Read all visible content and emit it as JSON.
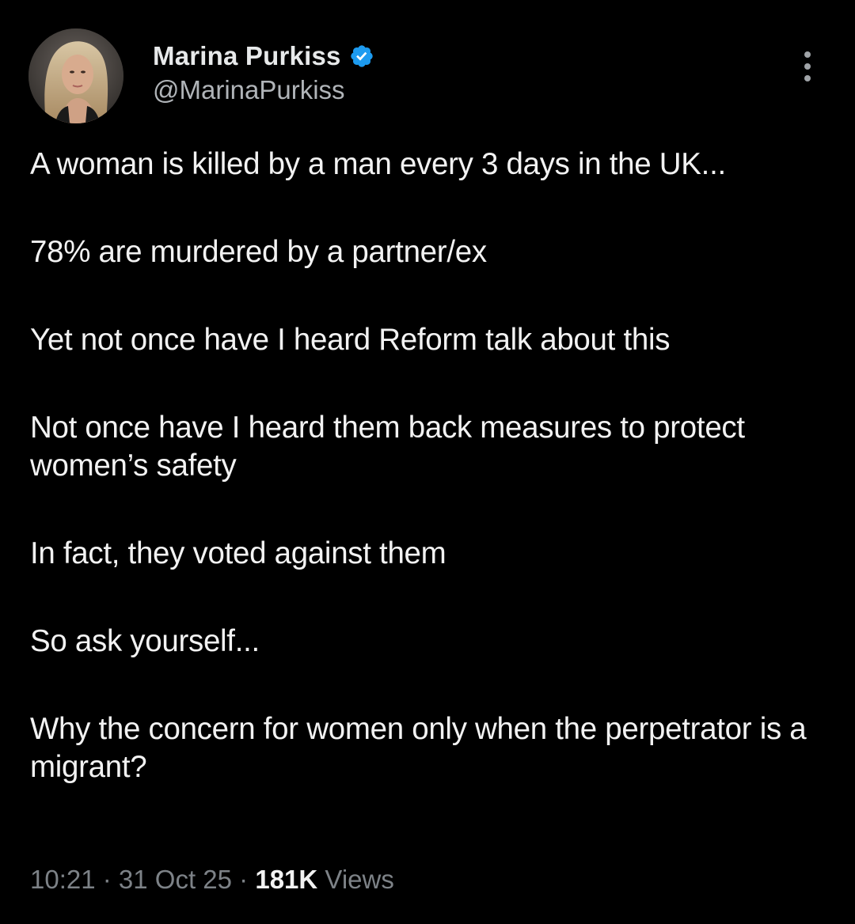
{
  "author": {
    "display_name": "Marina Purkiss",
    "handle": "@MarinaPurkiss",
    "verified": true,
    "verified_color": "#1d9bf0"
  },
  "icons": {
    "verified": "verified-badge-icon",
    "more": "more-options-icon"
  },
  "tweet": {
    "paragraphs": [
      "A woman is killed by a man every 3 days in the UK...",
      "78% are murdered by a partner/ex",
      "Yet not once have I heard Reform talk about this",
      "Not once have I heard them back measures to protect women’s safety",
      "In fact, they voted against them",
      "So ask yourself...",
      "Why the concern for women only when the perpetrator is a migrant?"
    ],
    "time": "10:21",
    "date": "31 Oct 25",
    "separator": " · ",
    "views_count": "181K",
    "views_label": "Views"
  },
  "colors": {
    "background": "#000000",
    "text": "#f2f2f2",
    "muted": "#7d8287"
  }
}
